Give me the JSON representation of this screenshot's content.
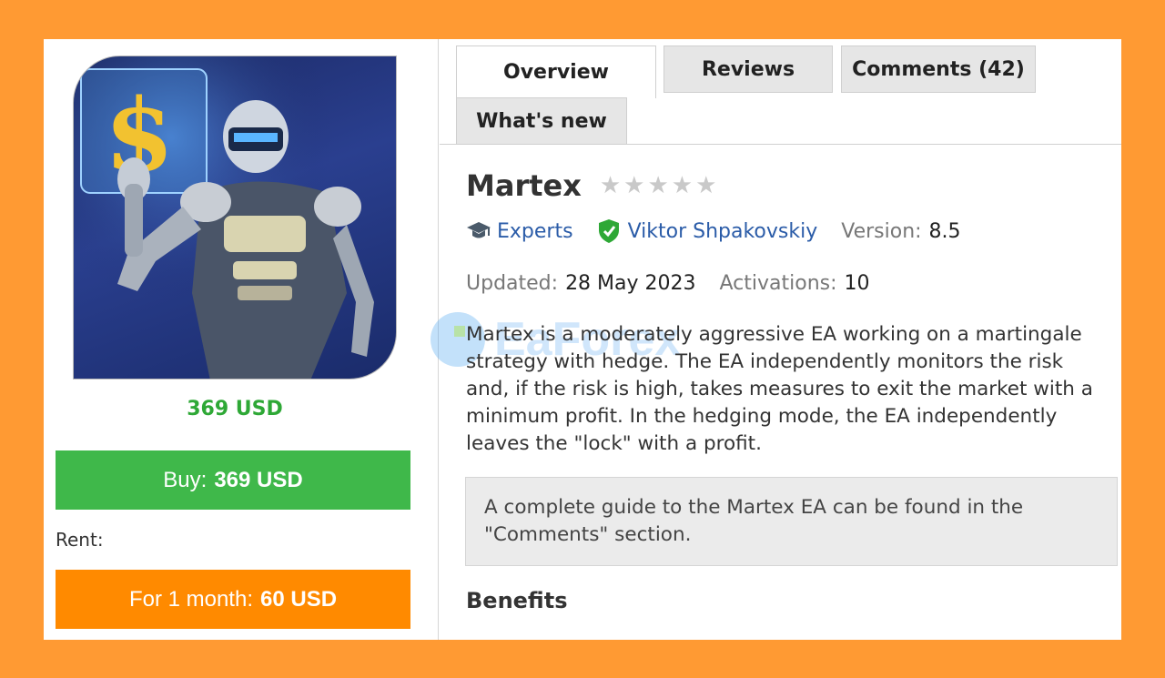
{
  "product": {
    "price": "369 USD",
    "buy_label": "Buy:",
    "buy_price": "369 USD",
    "rent_label": "Rent:",
    "rent_period": "For 1 month:",
    "rent_price": "60 USD"
  },
  "tabs": [
    {
      "label": "Overview",
      "active": true
    },
    {
      "label": "Reviews",
      "active": false
    },
    {
      "label": "Comments (42)",
      "active": false
    },
    {
      "label": "What's new",
      "active": false
    }
  ],
  "header": {
    "title": "Martex",
    "rating": 0,
    "rating_max": 5
  },
  "meta": {
    "category": "Experts",
    "author": "Viktor Shpakovskiy",
    "version_label": "Version:",
    "version": "8.5",
    "updated_label": "Updated:",
    "updated": "28 May 2023",
    "activations_label": "Activations:",
    "activations": "10"
  },
  "description": "Martex is a moderately aggressive EA working on a martingale strategy with hedge. The EA independently monitors the risk and, if the risk is high, takes measures to exit the market with a minimum profit. In the hedging mode, the EA independently leaves the \"lock\" with a profit.",
  "info_box": "A complete guide to the Martex EA can be found in the \"Comments\" section.",
  "section_heading": "Benefits",
  "watermark": "EaForex",
  "colors": {
    "frame": "#ff9a33",
    "buy": "#3fb84a",
    "rent": "#ff8a00",
    "price": "#2ea836",
    "link": "#2b5ca8"
  }
}
